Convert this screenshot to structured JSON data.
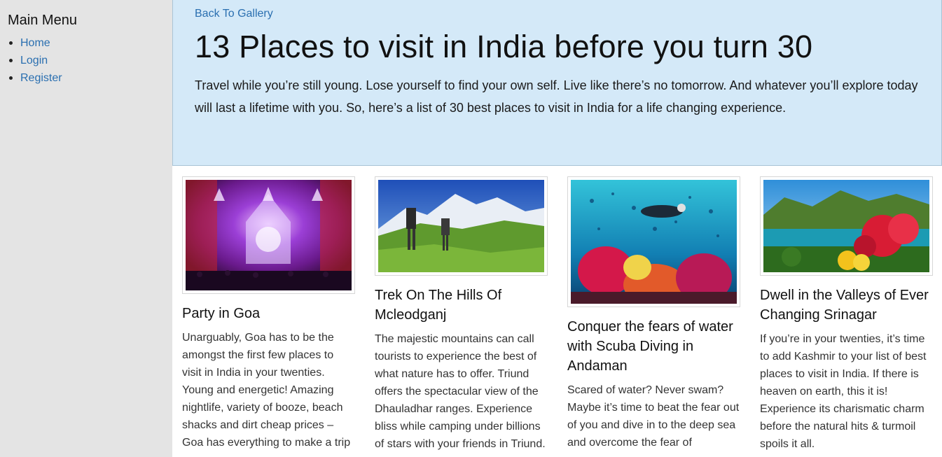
{
  "sidebar": {
    "title": "Main Menu",
    "items": [
      {
        "label": "Home"
      },
      {
        "label": "Login"
      },
      {
        "label": "Register"
      }
    ]
  },
  "header": {
    "back_link": "Back To Gallery",
    "title": "13 Places to visit in India before you turn 30",
    "intro": "Travel while you’re still young. Lose yourself to find your own self. Live like there’s no tomorrow. And whatever you’ll explore today will last a lifetime with you. So, here’s a list of 30 best places to visit in India for a life changing experience."
  },
  "cards": [
    {
      "title": "Party in Goa",
      "text": "Unarguably, Goa has to be the amongst the first few places to visit in India in your twenties. Young and energetic! Amazing nightlife, variety of booze, beach shacks and dirt cheap prices – Goa has everything to make a trip",
      "image": "concert-stage-image"
    },
    {
      "title": "Trek On The Hills Of Mcleodganj",
      "text": "The majestic mountains can call tourists to experience the best of what nature has to offer. Triund offers the spectacular view of the Dhauladhar ranges. Experience bliss while camping under billions of stars with your friends in Triund.",
      "image": "mountain-trekkers-image"
    },
    {
      "title": "Conquer the fears of water with Scuba Diving in Andaman",
      "text": "Scared of water? Never swam? Maybe it’s time to beat the fear out of you and dive in to the deep sea and overcome the fear of",
      "image": "scuba-reef-image"
    },
    {
      "title": "Dwell in the Valleys of Ever Changing Srinagar",
      "text": "If you’re in your twenties, it’s time to add Kashmir to your list of best places to visit in India. If there is heaven on earth, this it is! Experience its charismatic charm before the natural hits & turmoil spoils it all.",
      "image": "valley-lake-image"
    }
  ],
  "colors": {
    "sidebar_bg": "#e4e4e4",
    "hero_bg": "#d4e9f8",
    "link": "#2a6fb0"
  }
}
